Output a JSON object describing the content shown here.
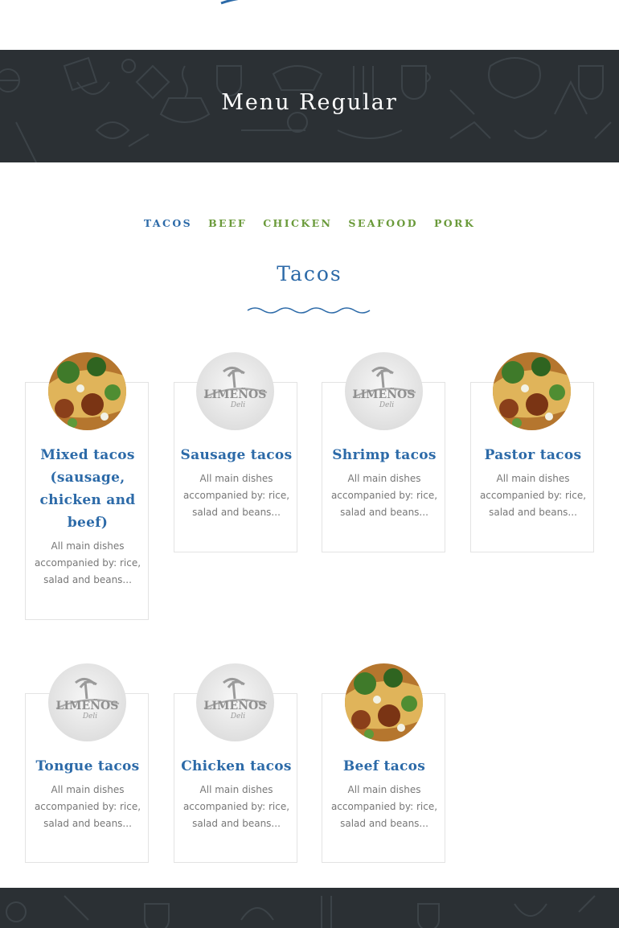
{
  "page": {
    "hero_title": "Menu Regular"
  },
  "categories": {
    "tabs": [
      "TACOS",
      "BEEF",
      "CHICKEN",
      "SEAFOOD",
      "PORK"
    ],
    "active_tab": "TACOS"
  },
  "section": {
    "title": "Tacos"
  },
  "logo_text": {
    "brand": "LIMEÑOS",
    "sub": "Deli"
  },
  "menu_items": [
    {
      "name": "Mixed tacos (sausage, chicken and beef)",
      "description": "All main dishes accompanied by: rice, salad and beans...",
      "image": "tacos-photo"
    },
    {
      "name": "Sausage tacos",
      "description": "All main dishes accompanied by: rice, salad and beans...",
      "image": "limenos-logo"
    },
    {
      "name": "Shrimp tacos",
      "description": "All main dishes accompanied by: rice, salad and beans...",
      "image": "limenos-logo"
    },
    {
      "name": "Pastor tacos",
      "description": "All main dishes accompanied by: rice, salad and beans...",
      "image": "tacos-photo"
    },
    {
      "name": "Tongue tacos",
      "description": "All main dishes accompanied by: rice, salad and beans...",
      "image": "limenos-logo"
    },
    {
      "name": "Chicken tacos",
      "description": "All main dishes accompanied by: rice, salad and beans...",
      "image": "limenos-logo"
    },
    {
      "name": "Beef tacos",
      "description": "All main dishes accompanied by: rice, salad and beans...",
      "image": "tacos-photo"
    }
  ],
  "colors": {
    "accent_blue": "#2c6aa8",
    "tab_green": "#6a9a3a",
    "dark_band": "#2b3034",
    "description_gray": "#777777"
  }
}
